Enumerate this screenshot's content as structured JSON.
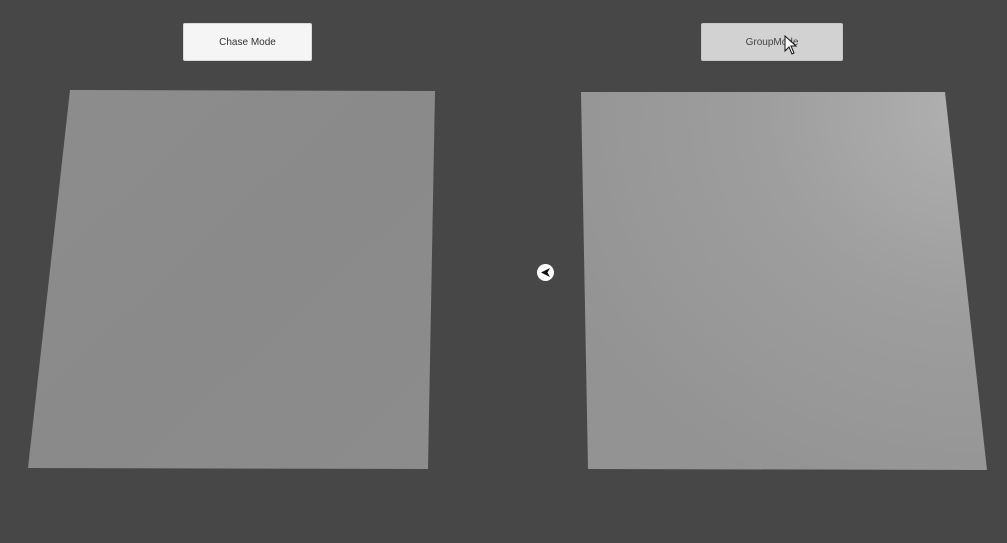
{
  "buttons": {
    "chase_label": "Chase Mode",
    "group_label": "GroupMode"
  },
  "colors": {
    "background": "#474747",
    "left_floor": "#8c8c8c",
    "right_floor": "#9a9a9a",
    "button_normal": "#f5f5f5",
    "button_hover": "#d2d2d2"
  },
  "icons": {
    "agent": "arrow-agent-icon",
    "cursor": "mouse-pointer-icon"
  }
}
